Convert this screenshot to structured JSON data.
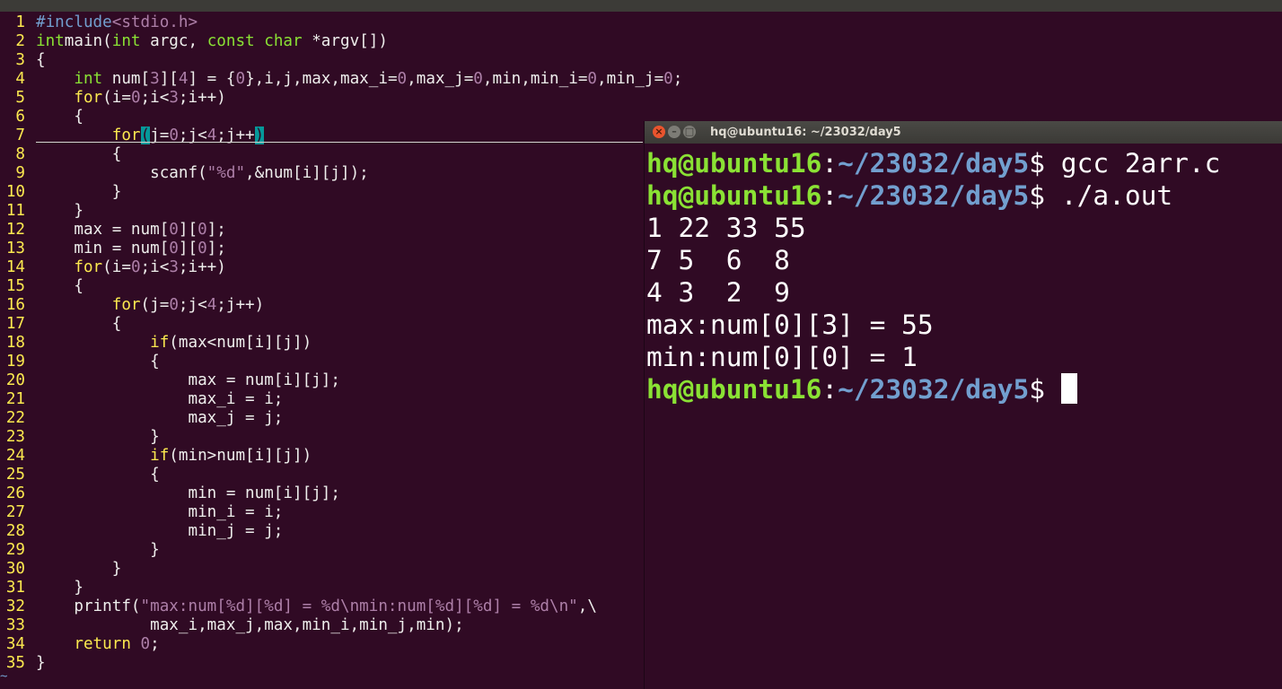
{
  "editor": {
    "lines": [
      {
        "n": "1",
        "tokens": [
          [
            "pp",
            "#include"
          ],
          [
            "str",
            "<stdio.h>"
          ]
        ]
      },
      {
        "n": "2",
        "tokens": [
          [
            "ty",
            "int"
          ],
          [
            "",
            "main("
          ],
          [
            "ty",
            "int"
          ],
          [
            "",
            " argc, "
          ],
          [
            "ty",
            "const"
          ],
          [
            "",
            " "
          ],
          [
            "ty",
            "char"
          ],
          [
            "",
            " *argv[])"
          ]
        ]
      },
      {
        "n": "3",
        "tokens": [
          [
            "",
            "{"
          ]
        ]
      },
      {
        "n": "4",
        "tokens": [
          [
            "",
            "    "
          ],
          [
            "ty",
            "int"
          ],
          [
            "",
            " num["
          ],
          [
            "num",
            "3"
          ],
          [
            "",
            "]["
          ],
          [
            "num",
            "4"
          ],
          [
            "",
            "] = {"
          ],
          [
            "num",
            "0"
          ],
          [
            "",
            "},i,j,max,max_i="
          ],
          [
            "num",
            "0"
          ],
          [
            "",
            ",max_j="
          ],
          [
            "num",
            "0"
          ],
          [
            "",
            ",min,min_i="
          ],
          [
            "num",
            "0"
          ],
          [
            "",
            ",min_j="
          ],
          [
            "num",
            "0"
          ],
          [
            "",
            ";"
          ]
        ]
      },
      {
        "n": "5",
        "tokens": [
          [
            "",
            "    "
          ],
          [
            "kw",
            "for"
          ],
          [
            "",
            "(i="
          ],
          [
            "num",
            "0"
          ],
          [
            "",
            ";i<"
          ],
          [
            "num",
            "3"
          ],
          [
            "",
            ";i++)"
          ]
        ]
      },
      {
        "n": "6",
        "tokens": [
          [
            "",
            "    {"
          ]
        ]
      },
      {
        "n": "7",
        "tokens": [
          [
            "",
            "        "
          ],
          [
            "kw",
            "for"
          ],
          [
            "cur",
            "("
          ],
          [
            "",
            "j="
          ],
          [
            "num",
            "0"
          ],
          [
            "",
            ";j<"
          ],
          [
            "num",
            "4"
          ],
          [
            "",
            ";j++"
          ],
          [
            "cur",
            ")"
          ]
        ]
      },
      {
        "n": "8",
        "tokens": [
          [
            "",
            "        {"
          ]
        ]
      },
      {
        "n": "9",
        "tokens": [
          [
            "",
            "            scanf("
          ],
          [
            "str",
            "\"%d\""
          ],
          [
            "",
            ",&num[i][j]);"
          ]
        ]
      },
      {
        "n": "10",
        "tokens": [
          [
            "",
            "        }"
          ]
        ]
      },
      {
        "n": "11",
        "tokens": [
          [
            "",
            "    }"
          ]
        ]
      },
      {
        "n": "12",
        "tokens": [
          [
            "",
            "    max = num["
          ],
          [
            "num",
            "0"
          ],
          [
            "",
            "]["
          ],
          [
            "num",
            "0"
          ],
          [
            "",
            "];"
          ]
        ]
      },
      {
        "n": "13",
        "tokens": [
          [
            "",
            "    min = num["
          ],
          [
            "num",
            "0"
          ],
          [
            "",
            "]["
          ],
          [
            "num",
            "0"
          ],
          [
            "",
            "];"
          ]
        ]
      },
      {
        "n": "14",
        "tokens": [
          [
            "",
            "    "
          ],
          [
            "kw",
            "for"
          ],
          [
            "",
            "(i="
          ],
          [
            "num",
            "0"
          ],
          [
            "",
            ";i<"
          ],
          [
            "num",
            "3"
          ],
          [
            "",
            ";i++)"
          ]
        ]
      },
      {
        "n": "15",
        "tokens": [
          [
            "",
            "    {"
          ]
        ]
      },
      {
        "n": "16",
        "tokens": [
          [
            "",
            "        "
          ],
          [
            "kw",
            "for"
          ],
          [
            "",
            "(j="
          ],
          [
            "num",
            "0"
          ],
          [
            "",
            ";j<"
          ],
          [
            "num",
            "4"
          ],
          [
            "",
            ";j++)"
          ]
        ]
      },
      {
        "n": "17",
        "tokens": [
          [
            "",
            "        {"
          ]
        ]
      },
      {
        "n": "18",
        "tokens": [
          [
            "",
            "            "
          ],
          [
            "kw",
            "if"
          ],
          [
            "",
            "(max<num[i][j])"
          ]
        ]
      },
      {
        "n": "19",
        "tokens": [
          [
            "",
            "            {"
          ]
        ]
      },
      {
        "n": "20",
        "tokens": [
          [
            "",
            "                max = num[i][j];"
          ]
        ]
      },
      {
        "n": "21",
        "tokens": [
          [
            "",
            "                max_i = i;"
          ]
        ]
      },
      {
        "n": "22",
        "tokens": [
          [
            "",
            "                max_j = j;"
          ]
        ]
      },
      {
        "n": "23",
        "tokens": [
          [
            "",
            "            }"
          ]
        ]
      },
      {
        "n": "24",
        "tokens": [
          [
            "",
            "            "
          ],
          [
            "kw",
            "if"
          ],
          [
            "",
            "(min>num[i][j])"
          ]
        ]
      },
      {
        "n": "25",
        "tokens": [
          [
            "",
            "            {"
          ]
        ]
      },
      {
        "n": "26",
        "tokens": [
          [
            "",
            "                min = num[i][j];"
          ]
        ]
      },
      {
        "n": "27",
        "tokens": [
          [
            "",
            "                min_i = i;"
          ]
        ]
      },
      {
        "n": "28",
        "tokens": [
          [
            "",
            "                min_j = j;"
          ]
        ]
      },
      {
        "n": "29",
        "tokens": [
          [
            "",
            "            }"
          ]
        ]
      },
      {
        "n": "30",
        "tokens": [
          [
            "",
            "        }"
          ]
        ]
      },
      {
        "n": "31",
        "tokens": [
          [
            "",
            "    }"
          ]
        ]
      },
      {
        "n": "32",
        "tokens": [
          [
            "",
            "    printf("
          ],
          [
            "str",
            "\"max:num[%d][%d] = %d\\nmin:num[%d][%d] = %d\\n\""
          ],
          [
            "",
            ",\\"
          ]
        ]
      },
      {
        "n": "33",
        "tokens": [
          [
            "",
            "            max_i,max_j,max,min_i,min_j,min);"
          ]
        ]
      },
      {
        "n": "34",
        "tokens": [
          [
            "",
            "    "
          ],
          [
            "kw",
            "return"
          ],
          [
            "",
            " "
          ],
          [
            "num",
            "0"
          ],
          [
            "",
            ";"
          ]
        ]
      },
      {
        "n": "35",
        "tokens": [
          [
            "",
            "}"
          ]
        ]
      }
    ],
    "tilde": "~"
  },
  "terminal": {
    "title": "hq@ubuntu16: ~/23032/day5",
    "buttons": {
      "close": "×",
      "minimize": "–",
      "maximize": "□"
    },
    "lines": [
      {
        "user": "hq@ubuntu16",
        "sep": ":",
        "dir": "~/23032/day5",
        "text": "$ gcc 2arr.c"
      },
      {
        "user": "hq@ubuntu16",
        "sep": ":",
        "dir": "~/23032/day5",
        "text": "$ ./a.out"
      },
      {
        "text": "1 22 33 55"
      },
      {
        "text": "7 5  6  8"
      },
      {
        "text": "4 3  2  9"
      },
      {
        "text": "max:num[0][3] = 55"
      },
      {
        "text": "min:num[0][0] = 1"
      },
      {
        "user": "hq@ubuntu16",
        "sep": ":",
        "dir": "~/23032/day5",
        "text": "$",
        "cursor": true
      }
    ]
  }
}
